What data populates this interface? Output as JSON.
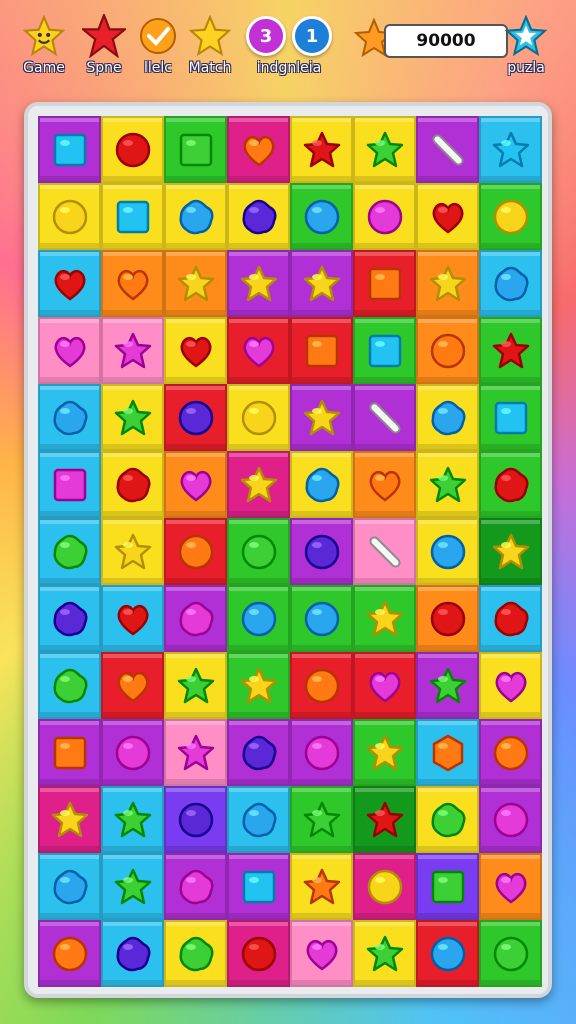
{
  "hud": {
    "items": [
      {
        "label": "Game",
        "icon": "smiley-star-icon"
      },
      {
        "label": "Spne",
        "icon": "red-star-icon"
      },
      {
        "label": "llelc",
        "icon": "check-icon"
      },
      {
        "label": "Match",
        "icon": "yellow-star-icon"
      },
      {
        "label": "indgnleia",
        "badges": [
          "3",
          "1"
        ]
      }
    ],
    "score": "90000",
    "puzzle_label": "puzla"
  },
  "colors": {
    "P": "#b030d6",
    "R": "#e81e2a",
    "G": "#2ec82a",
    "Y": "#f9df1e",
    "B": "#2cc0ee",
    "O": "#ff8c1a",
    "K": "#ff8ec6",
    "V": "#7a3cf0",
    "M": "#e0208a",
    "D": "#139a1c"
  },
  "pieces": {
    "r": "#e01616",
    "o": "#ff7a12",
    "y": "#f8d51a",
    "g": "#3ccf36",
    "b": "#2aa6ef",
    "v": "#5b28d8",
    "m": "#e33ad8",
    "c": "#22c3f2",
    "w": "#f2f2f2"
  },
  "board": [
    [
      [
        "P",
        "c",
        "square"
      ],
      [
        "Y",
        "r",
        "circle"
      ],
      [
        "G",
        "g",
        "square"
      ],
      [
        "M",
        "o",
        "heart"
      ],
      [
        "Y",
        "r",
        "star"
      ],
      [
        "Y",
        "g",
        "star"
      ],
      [
        "P",
        "w",
        "bar"
      ],
      [
        "B",
        "c",
        "star"
      ]
    ],
    [
      [
        "Y",
        "y",
        "circle"
      ],
      [
        "Y",
        "c",
        "square"
      ],
      [
        "Y",
        "b",
        "flower"
      ],
      [
        "Y",
        "v",
        "flower"
      ],
      [
        "G",
        "b",
        "circle"
      ],
      [
        "Y",
        "m",
        "circle"
      ],
      [
        "Y",
        "r",
        "heart"
      ],
      [
        "G",
        "y",
        "circle"
      ]
    ],
    [
      [
        "B",
        "r",
        "heart"
      ],
      [
        "O",
        "o",
        "heart"
      ],
      [
        "O",
        "y",
        "star"
      ],
      [
        "P",
        "y",
        "star"
      ],
      [
        "P",
        "y",
        "star"
      ],
      [
        "R",
        "o",
        "square"
      ],
      [
        "O",
        "y",
        "star"
      ],
      [
        "B",
        "b",
        "flower"
      ]
    ],
    [
      [
        "K",
        "m",
        "heart"
      ],
      [
        "K",
        "m",
        "star"
      ],
      [
        "Y",
        "r",
        "heart"
      ],
      [
        "R",
        "m",
        "heart"
      ],
      [
        "R",
        "o",
        "square"
      ],
      [
        "G",
        "c",
        "square"
      ],
      [
        "O",
        "o",
        "circle"
      ],
      [
        "G",
        "r",
        "star"
      ]
    ],
    [
      [
        "B",
        "b",
        "flower"
      ],
      [
        "Y",
        "g",
        "star"
      ],
      [
        "R",
        "v",
        "circle"
      ],
      [
        "Y",
        "y",
        "circle"
      ],
      [
        "P",
        "y",
        "star"
      ],
      [
        "P",
        "w",
        "bar"
      ],
      [
        "Y",
        "b",
        "flower"
      ],
      [
        "G",
        "c",
        "square"
      ]
    ],
    [
      [
        "B",
        "m",
        "square"
      ],
      [
        "Y",
        "r",
        "flower"
      ],
      [
        "O",
        "m",
        "heart"
      ],
      [
        "M",
        "y",
        "star"
      ],
      [
        "Y",
        "b",
        "flower"
      ],
      [
        "O",
        "o",
        "heart"
      ],
      [
        "Y",
        "g",
        "star"
      ],
      [
        "G",
        "r",
        "flower"
      ]
    ],
    [
      [
        "B",
        "g",
        "flower"
      ],
      [
        "Y",
        "y",
        "star"
      ],
      [
        "R",
        "o",
        "circle"
      ],
      [
        "G",
        "g",
        "circle"
      ],
      [
        "P",
        "v",
        "circle"
      ],
      [
        "K",
        "w",
        "bar"
      ],
      [
        "Y",
        "b",
        "circle"
      ],
      [
        "D",
        "y",
        "star"
      ]
    ],
    [
      [
        "B",
        "v",
        "flower"
      ],
      [
        "B",
        "r",
        "heart"
      ],
      [
        "P",
        "m",
        "flower"
      ],
      [
        "G",
        "b",
        "circle"
      ],
      [
        "G",
        "b",
        "circle"
      ],
      [
        "G",
        "y",
        "star"
      ],
      [
        "O",
        "r",
        "circle"
      ],
      [
        "B",
        "r",
        "flower"
      ]
    ],
    [
      [
        "B",
        "g",
        "flower"
      ],
      [
        "R",
        "o",
        "heart"
      ],
      [
        "Y",
        "g",
        "star"
      ],
      [
        "G",
        "y",
        "star"
      ],
      [
        "R",
        "o",
        "circle"
      ],
      [
        "R",
        "m",
        "heart"
      ],
      [
        "P",
        "g",
        "star"
      ],
      [
        "Y",
        "m",
        "heart"
      ]
    ],
    [
      [
        "P",
        "o",
        "square"
      ],
      [
        "P",
        "m",
        "circle"
      ],
      [
        "K",
        "m",
        "star"
      ],
      [
        "P",
        "v",
        "flower"
      ],
      [
        "P",
        "m",
        "circle"
      ],
      [
        "G",
        "y",
        "star"
      ],
      [
        "B",
        "o",
        "hex"
      ],
      [
        "P",
        "o",
        "circle"
      ]
    ],
    [
      [
        "M",
        "y",
        "star"
      ],
      [
        "B",
        "g",
        "star"
      ],
      [
        "V",
        "v",
        "circle"
      ],
      [
        "B",
        "b",
        "flower"
      ],
      [
        "G",
        "g",
        "star"
      ],
      [
        "D",
        "r",
        "star"
      ],
      [
        "Y",
        "g",
        "flower"
      ],
      [
        "P",
        "m",
        "circle"
      ]
    ],
    [
      [
        "B",
        "b",
        "flower"
      ],
      [
        "B",
        "g",
        "star"
      ],
      [
        "P",
        "m",
        "flower"
      ],
      [
        "P",
        "c",
        "square"
      ],
      [
        "Y",
        "o",
        "star"
      ],
      [
        "M",
        "y",
        "circle"
      ],
      [
        "V",
        "g",
        "square"
      ],
      [
        "O",
        "m",
        "heart"
      ]
    ],
    [
      [
        "P",
        "o",
        "circle"
      ],
      [
        "B",
        "v",
        "flower"
      ],
      [
        "Y",
        "g",
        "flower"
      ],
      [
        "M",
        "r",
        "circle"
      ],
      [
        "K",
        "m",
        "heart"
      ],
      [
        "Y",
        "g",
        "star"
      ],
      [
        "R",
        "b",
        "circle"
      ],
      [
        "G",
        "g",
        "circle"
      ]
    ]
  ]
}
